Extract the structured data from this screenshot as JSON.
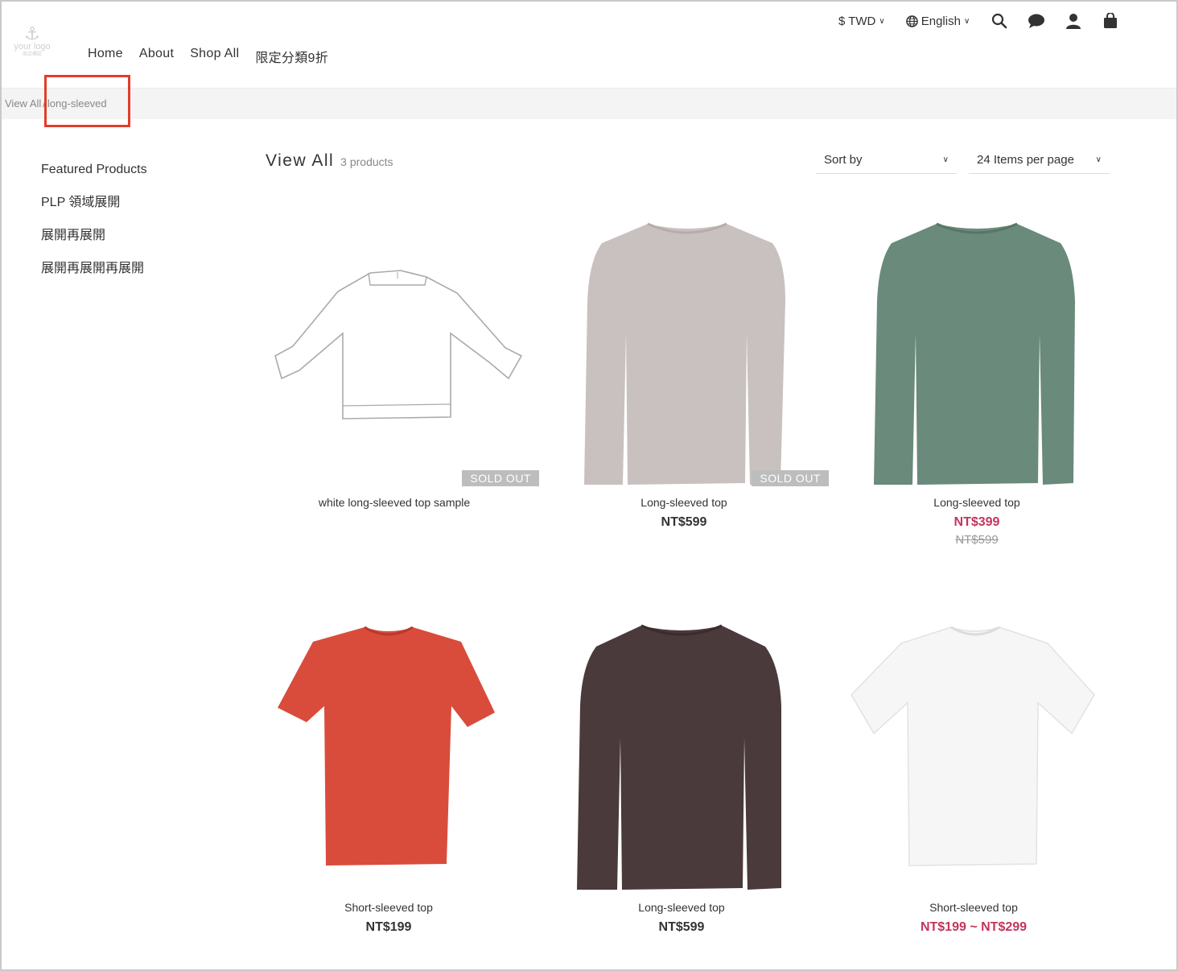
{
  "header": {
    "logo": {
      "text": "your logo",
      "subtext": "商店標誌"
    },
    "nav": [
      "Home",
      "About",
      "Shop All",
      "限定分類9折"
    ],
    "currency": "$ TWD",
    "language": "English"
  },
  "breadcrumb": {
    "root": "View All",
    "separator": "/",
    "current": "long-sleeved"
  },
  "sidebar": {
    "categories": [
      "Featured Products",
      "PLP 領域展開",
      "展開再展開",
      "展開再展開再展開"
    ]
  },
  "listing": {
    "title": "View All",
    "count": "3 products",
    "sort_label": "Sort by",
    "per_page_label": "24 Items per page"
  },
  "products": [
    {
      "name": "white long-sleeved top sample",
      "badge": "SOLD OUT",
      "color": "#ffffff"
    },
    {
      "name": "Long-sleeved top",
      "price": "NT$599",
      "badge": "SOLD OUT",
      "color": "#c8c1c0"
    },
    {
      "name": "Long-sleeved top",
      "sale_price": "NT$399",
      "original_price": "NT$599",
      "color": "#6a8a7b"
    },
    {
      "name": "Short-sleeved top",
      "price": "NT$199",
      "color": "#d94c3c"
    },
    {
      "name": "Long-sleeved top",
      "price": "NT$599",
      "color": "#4a3a3b"
    },
    {
      "name": "Short-sleeved top",
      "sale_price": "NT$199 ~ NT$299",
      "color": "#f4f4f4"
    }
  ],
  "colors": {
    "accent_sale": "#c3355c",
    "highlight": "#e23d2b"
  }
}
